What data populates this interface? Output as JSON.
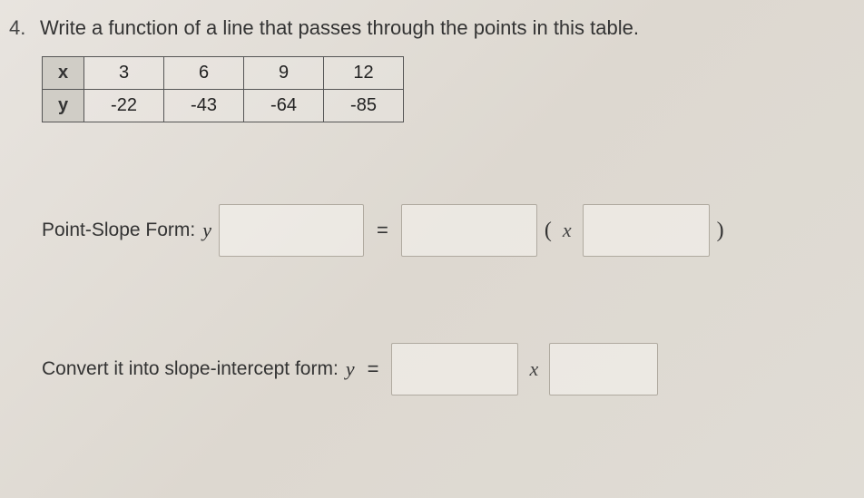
{
  "question": {
    "number": "4.",
    "text": "Write a function of a line that passes through the points in this table."
  },
  "table": {
    "row_x_label": "x",
    "row_y_label": "y",
    "x_values": [
      "3",
      "6",
      "9",
      "12"
    ],
    "y_values": [
      "-22",
      "-43",
      "-64",
      "-85"
    ]
  },
  "point_slope": {
    "label": "Point-Slope Form:",
    "y": "y",
    "equals": "=",
    "open_paren": "(",
    "x": "x",
    "close_paren": ")"
  },
  "slope_intercept": {
    "label": "Convert it into slope-intercept form:",
    "y": "y",
    "equals": "=",
    "x": "x"
  },
  "chart_data": {
    "type": "table",
    "columns": [
      "x",
      "y"
    ],
    "rows": [
      {
        "x": 3,
        "y": -22
      },
      {
        "x": 6,
        "y": -43
      },
      {
        "x": 9,
        "y": -64
      },
      {
        "x": 12,
        "y": -85
      }
    ]
  }
}
